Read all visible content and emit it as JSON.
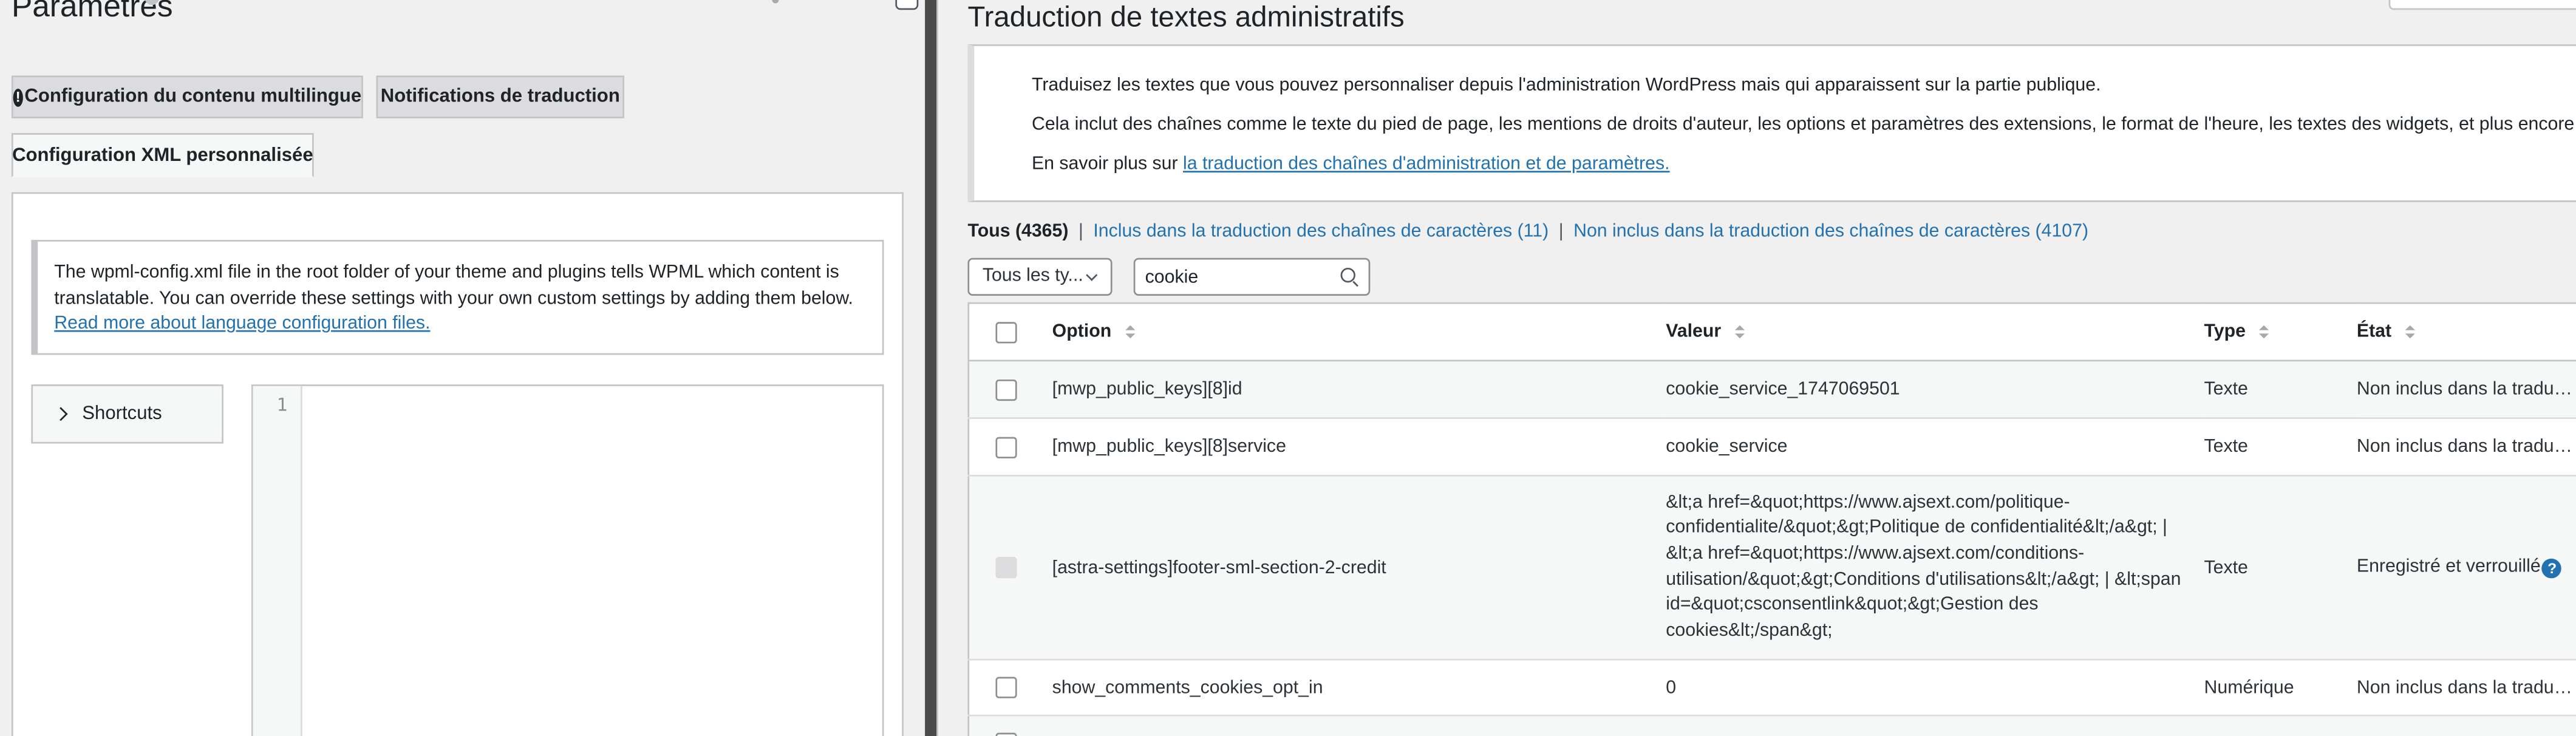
{
  "left": {
    "title": "Paramètres",
    "tabs": {
      "multilingual": "Configuration du contenu multilingue",
      "multilingual_alert_icon": "!",
      "notifications": "Notifications de traduction",
      "custom_xml": "Configuration XML personnalisée"
    },
    "notice": {
      "text": "The wpml-config.xml file in the root folder of your theme and plugins tells WPML which content is translatable. You can override these settings with your own custom settings by adding them below.",
      "link": "Read more about language configuration files."
    },
    "shortcuts_label": "Shortcuts",
    "editor_line_number": "1",
    "icons": {
      "shortcuts_toggle": "chevron-right-icon",
      "multilingual_alert": "alert-icon"
    }
  },
  "right": {
    "title": "Traduction de textes administratifs",
    "intro": {
      "p1": "Traduisez les textes que vous pouvez personnaliser depuis l'administration WordPress mais qui apparaissent sur la partie publique.",
      "p2": "Cela inclut des chaînes comme le texte du pied de page, les mentions de droits d'auteur, les options et paramètres des extensions, le format de l'heure, les textes des widgets, et plus encore.",
      "p3_prefix": "En savoir plus sur ",
      "p3_link": "la traduction des chaînes d'administration et de paramètres."
    },
    "filters": {
      "all": "Tous (4365)",
      "included": "Inclus dans la traduction des chaînes de caractères (11)",
      "not_included": "Non inclus dans la traduction des chaînes de caractères (4107)",
      "separator": "|"
    },
    "type_select": {
      "selected": "Tous les ty..."
    },
    "search": {
      "value": "cookie"
    },
    "table": {
      "headers": {
        "option": "Option",
        "value": "Valeur",
        "type": "Type",
        "state": "État"
      },
      "rows": [
        {
          "option": "[mwp_public_keys][8]id",
          "value": "cookie_service_1747069501",
          "type": "Texte",
          "state": "Non inclus dans la traduction des chaînes de caractères"
        },
        {
          "option": "[mwp_public_keys][8]service",
          "value": "cookie_service",
          "type": "Texte",
          "state": "Non inclus dans la traduction des chaînes de caractères"
        },
        {
          "option": "[astra-settings]footer-sml-section-2-credit",
          "value": "&lt;a href=&quot;https://www.ajsext.com/politique-confidentialite/&quot;&gt;Politique de confidentialité&lt;/a&gt; | &lt;a href=&quot;https://www.ajsext.com/conditions-utilisation/&quot;&gt;Conditions d'utilisations&lt;/a&gt; | &lt;span id=&quot;csconsentlink&quot;&gt;Gestion des cookies&lt;/span&gt;",
          "type": "Texte",
          "state": "Enregistré et verrouillé"
        },
        {
          "option": "show_comments_cookies_opt_in",
          "value": "0",
          "type": "Numérique",
          "state": "Non inclus dans la traduction des chaînes de caractères"
        }
      ]
    },
    "help_icon_glyph": "?",
    "icons": {
      "search": "search-icon",
      "help": "help-icon",
      "sort": "sort-arrows-icon"
    }
  }
}
